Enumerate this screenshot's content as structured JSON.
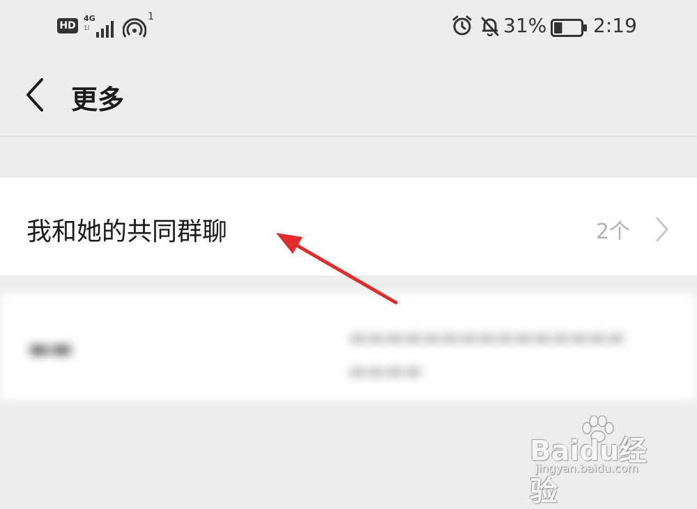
{
  "status_bar": {
    "hd_label": "HD",
    "network_type": "4G",
    "network_sub": "1l",
    "hotspot_count": "1",
    "battery_percent": "31%",
    "battery_level": 0.31,
    "time": "2:19",
    "icons": [
      "hd-badge",
      "signal-icon",
      "hotspot-icon",
      "alarm-icon",
      "bell-off-icon",
      "battery-icon"
    ]
  },
  "nav": {
    "back_icon": "chevron-left-icon",
    "title": "更多"
  },
  "common_groups_row": {
    "label": "我和她的共同群聊",
    "count": "2个",
    "icon": "chevron-right-icon"
  },
  "blurred_row": {
    "label": "▬▬",
    "description_line1": "▬▬▬▬▬▬▬▬▬▬▬▬▬▬▬",
    "description_line2": "▬▬▬▬"
  },
  "annotation": {
    "color": "#e52b2b"
  },
  "watermark": {
    "brand": "Baidu经验",
    "url": "jingyan.baidu.com"
  },
  "colors": {
    "background": "#ededed",
    "card": "#ffffff",
    "muted_text": "#b3b3b3",
    "arrow": "#e52b2b"
  }
}
